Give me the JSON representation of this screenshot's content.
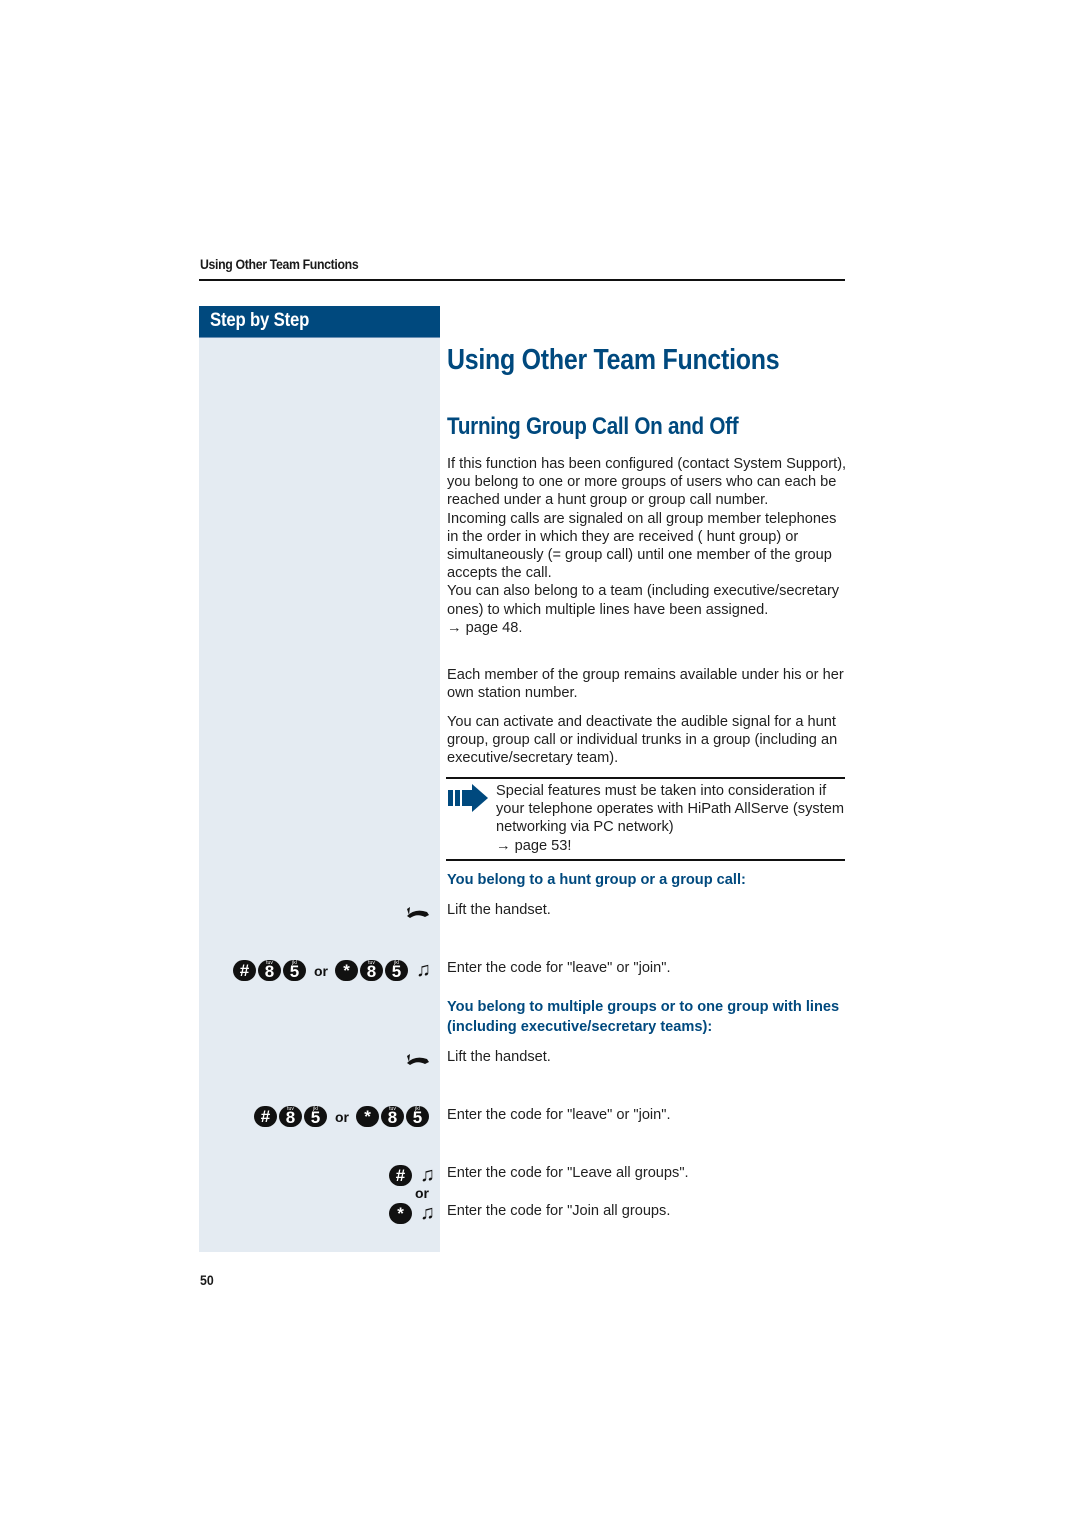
{
  "running_header": "Using Other Team Functions",
  "sidebar": {
    "title": "Step by Step"
  },
  "main": {
    "title": "Using Other Team Functions",
    "section_title": "Turning Group Call On and Off",
    "intro_paragraphs": [
      "If this function has been configured (contact System Support), you belong to one or more groups of users who can each be reached under a hunt group or group call number.",
      "Incoming calls are signaled on all group member telephones in the order in which they are received ( hunt group) or simultaneously (= group call) until one member of the group accepts the call.",
      "You can also belong to a team (including executive/secretary ones) to which multiple lines have been assigned.",
      "→ page 48."
    ],
    "paragraph_2": "Each member of the group remains available under his or her own station number.",
    "paragraph_3": "You can activate and deactivate the audible signal for a hunt group, group call or individual trunks in a group (including an executive/secretary team).",
    "note": {
      "icon": "arrow-note-icon",
      "text": "Special features must be taken into consideration if your telephone operates with HiPath AllServe (system networking via PC network)",
      "ref": "→ page 53!"
    },
    "subsections": [
      {
        "heading": "You belong to a hunt group or a group call:",
        "steps": [
          {
            "icon": "handset-lift-icon",
            "text": "Lift the handset."
          },
          {
            "keys_a": [
              "#",
              "8",
              "5"
            ],
            "or": "or",
            "keys_b": [
              "*",
              "8",
              "5"
            ],
            "tone_icon": "♫",
            "text": "Enter the code for \"leave\" or \"join\"."
          }
        ]
      },
      {
        "heading": "You belong to multiple groups or to one group with lines (including executive/secretary teams):",
        "steps": [
          {
            "icon": "handset-lift-icon",
            "text": "Lift the handset."
          },
          {
            "keys_a": [
              "#",
              "8",
              "5"
            ],
            "or": "or",
            "keys_b": [
              "*",
              "8",
              "5"
            ],
            "text": "Enter the code for \"leave\" or \"join\"."
          },
          {
            "keys": [
              "#"
            ],
            "tone_icon": "♫",
            "text": "Enter the code for \"Leave all groups\"."
          },
          {
            "or": "or"
          },
          {
            "keys": [
              "*"
            ],
            "tone_icon": "♫",
            "text": "Enter the code for \"Join all groups."
          }
        ]
      }
    ]
  },
  "key_sublabels": {
    "8": "tuv",
    "5": "jkl"
  },
  "page_number": "50",
  "colors": {
    "brand_blue": "#00497e",
    "sidebar_bg": "#e4ebf2",
    "rule": "#111111"
  }
}
